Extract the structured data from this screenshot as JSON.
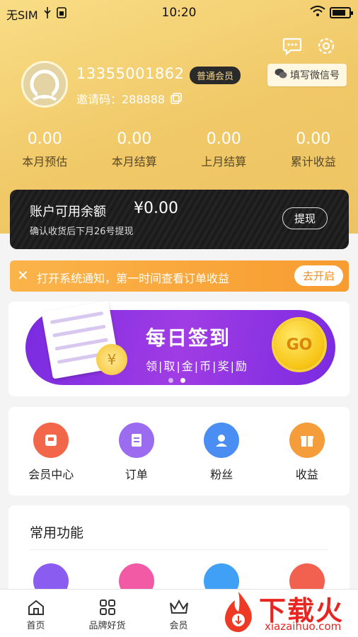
{
  "statusbar": {
    "carrier": "无SIM",
    "time": "10:20"
  },
  "profile": {
    "phone": "13355001862",
    "member_level": "普通会员",
    "invite_label": "邀请码：288888",
    "wechat_button": "填写微信号"
  },
  "stats": [
    {
      "value": "0.00",
      "label": "本月预估"
    },
    {
      "value": "0.00",
      "label": "本月结算"
    },
    {
      "value": "0.00",
      "label": "上月结算"
    },
    {
      "value": "0.00",
      "label": "累计收益"
    }
  ],
  "balance": {
    "title": "账户可用余额",
    "amount": "¥0.00",
    "note": "确认收货后下月26号提现",
    "withdraw_label": "提现"
  },
  "notice": {
    "text": "打开系统通知，第一时间查看订单收益",
    "action": "去开启"
  },
  "banner": {
    "title": "每日签到",
    "subtitle": "领|取|金|币|奖|励",
    "coin_text": "GO",
    "coin_mark": "¥"
  },
  "menu": [
    {
      "label": "会员中心",
      "color": "#f2664a"
    },
    {
      "label": "订单",
      "color": "#9b6cf0"
    },
    {
      "label": "粉丝",
      "color": "#4a8ef4"
    },
    {
      "label": "收益",
      "color": "#f59d3a"
    }
  ],
  "common": {
    "title": "常用功能",
    "icon_colors": [
      "#8b5cf0",
      "#f25aa5",
      "#3fa0f5",
      "#f2614f"
    ]
  },
  "tabbar": [
    {
      "label": "首页",
      "icon": "home-icon"
    },
    {
      "label": "品牌好货",
      "icon": "grid-icon"
    },
    {
      "label": "会员",
      "icon": "crown-icon"
    },
    {
      "label": "",
      "icon": ""
    },
    {
      "label": "",
      "icon": ""
    }
  ],
  "watermark": {
    "brand": "下载火",
    "url": "xiazaihuo.com"
  }
}
